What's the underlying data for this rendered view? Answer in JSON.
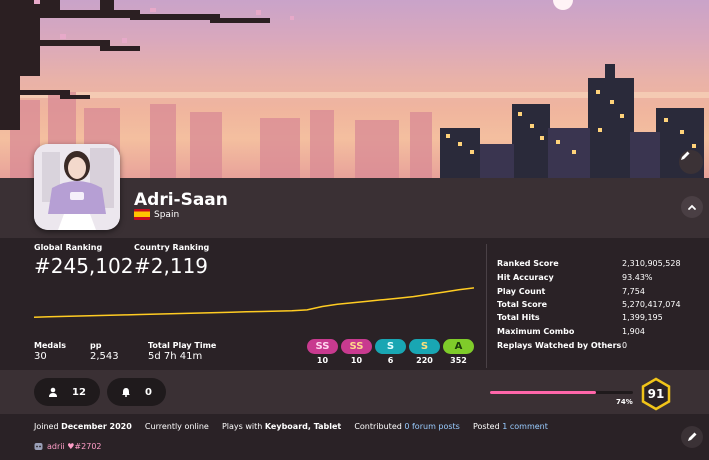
{
  "user": {
    "username": "Adri-Saan",
    "country": "Spain"
  },
  "ranking": {
    "global_label": "Global Ranking",
    "global_value": "#245,102",
    "country_label": "Country Ranking",
    "country_value": "#2,119"
  },
  "summary": {
    "medals_label": "Medals",
    "medals_value": "30",
    "pp_label": "pp",
    "pp_value": "2,543",
    "playtime_label": "Total Play Time",
    "playtime_value": "5d 7h 41m"
  },
  "grades": [
    {
      "label": "SS",
      "count": "10",
      "bg": "#c83a8f",
      "fg": "#ffd6ef"
    },
    {
      "label": "SS",
      "count": "10",
      "bg": "#c83a8f",
      "fg": "#ffd98a"
    },
    {
      "label": "S",
      "count": "6",
      "bg": "#19a6b3",
      "fg": "#e6ffff"
    },
    {
      "label": "S",
      "count": "220",
      "bg": "#19a6b3",
      "fg": "#ffe07a"
    },
    {
      "label": "A",
      "count": "352",
      "bg": "#7fcc2a",
      "fg": "#1a3a0a"
    }
  ],
  "stats": [
    {
      "label": "Ranked Score",
      "value": "2,310,905,528"
    },
    {
      "label": "Hit Accuracy",
      "value": "93.43%"
    },
    {
      "label": "Play Count",
      "value": "7,754"
    },
    {
      "label": "Total Score",
      "value": "5,270,417,074"
    },
    {
      "label": "Total Hits",
      "value": "1,399,195"
    },
    {
      "label": "Maximum Combo",
      "value": "1,904"
    },
    {
      "label": "Replays Watched by Others",
      "value": "0"
    }
  ],
  "rank_history": {
    "color": "#ffcc22",
    "points": [
      0.18,
      0.19,
      0.2,
      0.21,
      0.22,
      0.23,
      0.24,
      0.25,
      0.26,
      0.27,
      0.28,
      0.29,
      0.3,
      0.31,
      0.32,
      0.33,
      0.34,
      0.35,
      0.37,
      0.46,
      0.52,
      0.56,
      0.6,
      0.64,
      0.68,
      0.72,
      0.78,
      0.84,
      0.9,
      0.95
    ]
  },
  "social": {
    "followers": "12",
    "notifications": "0"
  },
  "level": {
    "value": "91",
    "progress_label": "74%",
    "progress": 0.74,
    "accent": "#ff66aa",
    "badge_color": "#f0c419"
  },
  "info": {
    "joined_prefix": "Joined",
    "joined_date": "December 2020",
    "online_status": "Currently online",
    "plays_prefix": "Plays with",
    "plays_devices": "Keyboard, Tablet",
    "contributed_prefix": "Contributed",
    "forum_posts": "0 forum posts",
    "posted_prefix": "Posted",
    "comments": "1 comment",
    "discord": "adrii ♥#2702"
  }
}
